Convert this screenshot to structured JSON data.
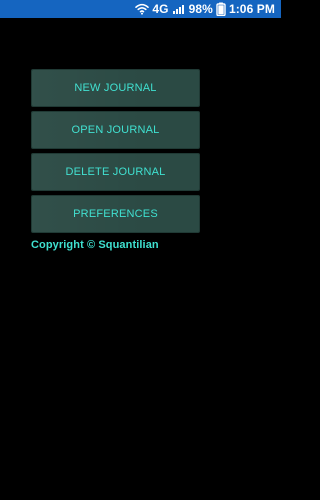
{
  "status_bar": {
    "network_label": "4G",
    "battery": "98%",
    "time": "1:06 PM",
    "icons": [
      "wifi-icon",
      "signal-icon",
      "battery-icon"
    ]
  },
  "menu": {
    "items": [
      {
        "label": "NEW JOURNAL"
      },
      {
        "label": "OPEN JOURNAL"
      },
      {
        "label": "DELETE JOURNAL"
      },
      {
        "label": "PREFERENCES"
      }
    ]
  },
  "footer": {
    "copyright": "Copyright © Squantilian"
  },
  "colors": {
    "status_bar_bg": "#1565c0",
    "button_bg": "#2b4a44",
    "accent_text": "#3fe0d0",
    "app_bg": "#000000"
  }
}
